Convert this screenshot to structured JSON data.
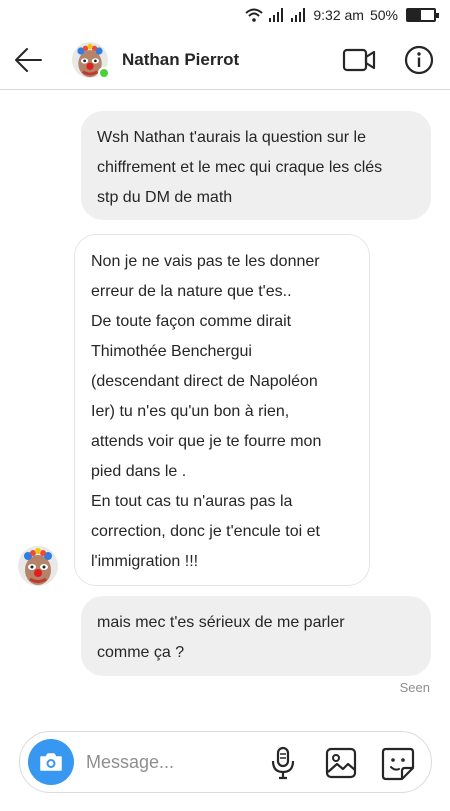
{
  "status_bar": {
    "time": "9:32 am",
    "battery_text": "50%",
    "battery_level": 0.5,
    "icons": [
      "wifi-icon",
      "signal-icon",
      "signal-icon",
      "battery-icon"
    ]
  },
  "header": {
    "contact_name": "Nathan Pierrot",
    "online": true,
    "icons": [
      "back-arrow-icon",
      "avatar",
      "video-camera-icon",
      "info-icon"
    ]
  },
  "messages": [
    {
      "direction": "sent",
      "lines": [
        "Wsh Nathan t'aurais la question sur le",
        "chiffrement et le mec qui craque les clés",
        "stp du DM de math"
      ]
    },
    {
      "direction": "received",
      "lines": [
        "Non je ne vais pas te les donner",
        "erreur de la nature que t'es..",
        "De toute façon comme dirait",
        "Thimothée Benchergui",
        "(descendant direct de Napoléon",
        "Ier) tu n'es qu'un bon à rien,",
        "attends voir que je te fourre mon",
        "pied dans le .",
        "En tout cas tu n'auras pas la",
        "correction, donc je t'encule toi et",
        "l'immigration !!!"
      ]
    },
    {
      "direction": "sent",
      "lines": [
        "mais mec t'es sérieux de me parler",
        "comme ça ?"
      ]
    }
  ],
  "seen_label": "Seen",
  "composer": {
    "placeholder": "Message...",
    "value": "",
    "icons": [
      "camera-icon",
      "microphone-icon",
      "gallery-icon",
      "sticker-icon"
    ]
  },
  "colors": {
    "accent": "#3897f0",
    "sent_bubble": "#efefef",
    "online": "#4cd137",
    "muted_text": "#8e8e8e"
  }
}
